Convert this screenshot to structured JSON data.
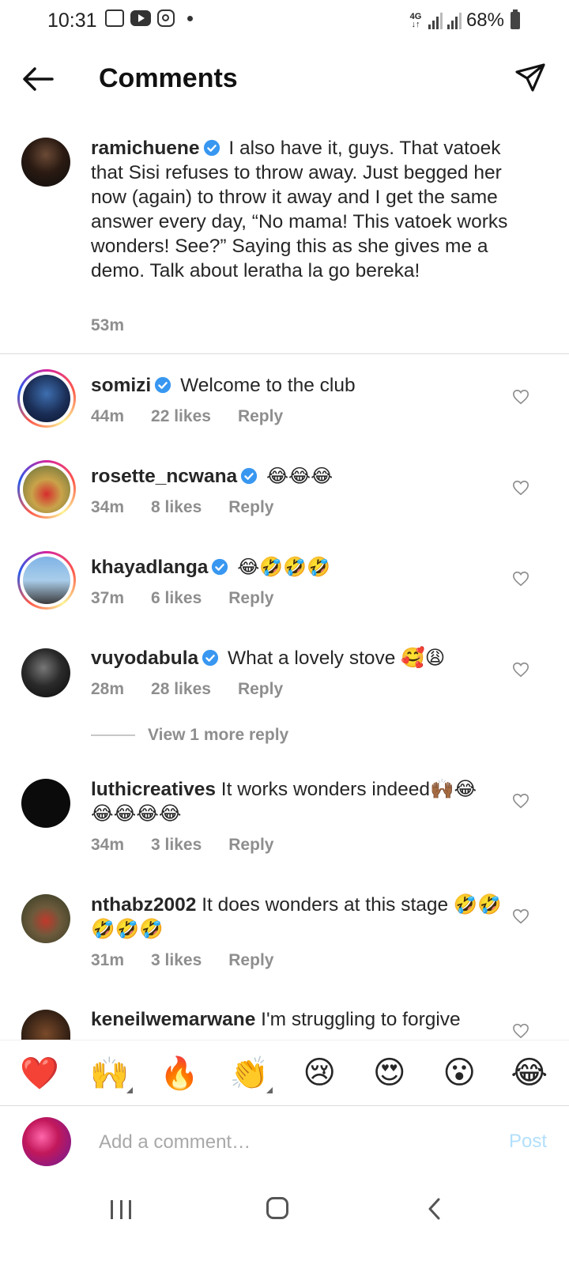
{
  "status_bar": {
    "time": "10:31",
    "network": "4G",
    "battery": "68%"
  },
  "header": {
    "title": "Comments"
  },
  "caption": {
    "username": "ramichuene",
    "text": "I also have it, guys. That vatoek that Sisi refuses to throw away. Just begged her now (again) to throw it away and I get the same answer every day, “No mama! This vatoek works wonders! See?” Saying this as she gives me a demo. Talk about leratha la go bereka!",
    "time": "53m"
  },
  "comments": [
    {
      "username": "somizi",
      "verified": true,
      "text": "Welcome to the club",
      "time": "44m",
      "likes": "22 likes",
      "reply": "Reply"
    },
    {
      "username": "rosette_ncwana",
      "verified": true,
      "text": "😂😂😂",
      "time": "34m",
      "likes": "8 likes",
      "reply": "Reply"
    },
    {
      "username": "khayadlanga",
      "verified": true,
      "text": "😂🤣🤣🤣",
      "time": "37m",
      "likes": "6 likes",
      "reply": "Reply"
    },
    {
      "username": "vuyodabula",
      "verified": true,
      "text": "What a lovely stove 🥰😩",
      "time": "28m",
      "likes": "28 likes",
      "reply": "Reply"
    },
    {
      "username": "luthicreatives",
      "verified": false,
      "text": "It works wonders indeed🙌🏾😂 😂😂😂😂",
      "time": "34m",
      "likes": "3 likes",
      "reply": "Reply"
    },
    {
      "username": "nthabz2002",
      "verified": false,
      "text": "It does wonders at this stage 🤣🤣🤣🤣🤣",
      "time": "31m",
      "likes": "3 likes",
      "reply": "Reply"
    },
    {
      "username": "keneilwemarwane",
      "verified": false,
      "text": "I'm struggling to forgive"
    }
  ],
  "view_more": "View 1 more reply",
  "reactions": [
    "❤️",
    "🙌",
    "🔥",
    "👏",
    "😢",
    "😍",
    "😮",
    "😂"
  ],
  "composer": {
    "placeholder": "Add a comment…",
    "post_label": "Post"
  }
}
